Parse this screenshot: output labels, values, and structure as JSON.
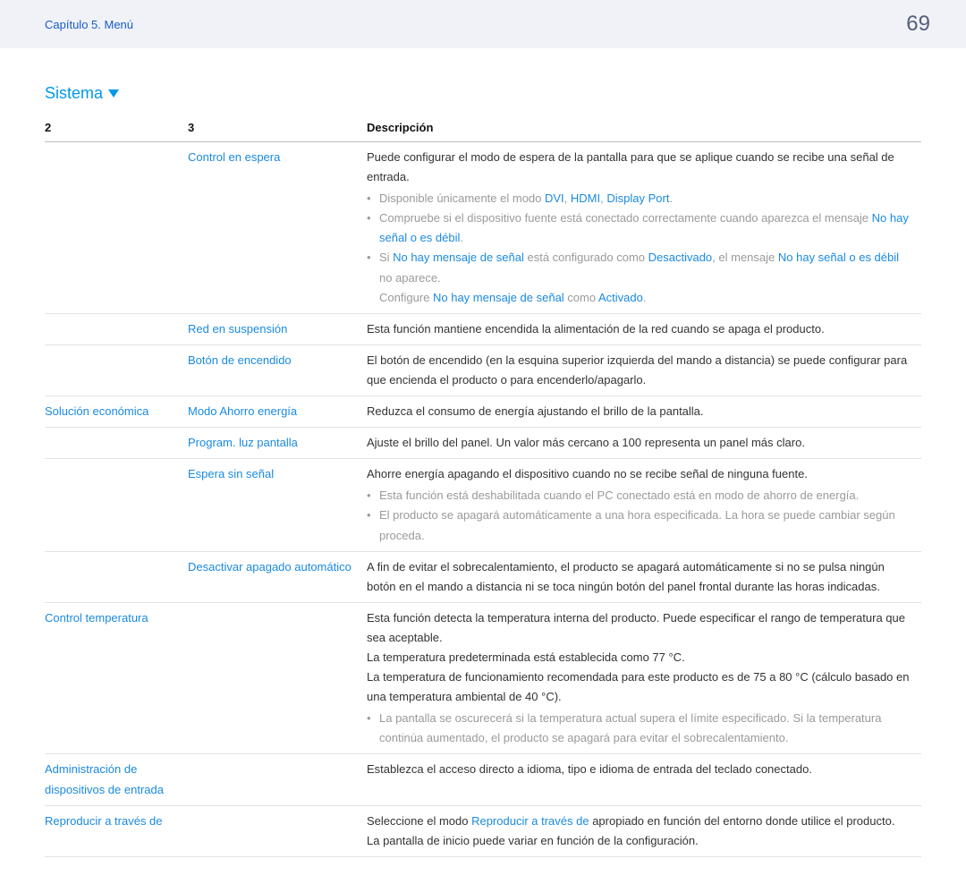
{
  "header": {
    "breadcrumb": "Capítulo 5. Menú",
    "page": "69"
  },
  "section": {
    "title": "Sistema"
  },
  "table": {
    "headers": {
      "c1": "2",
      "c2": "3",
      "c3": "Descripción"
    },
    "rows": [
      {
        "c1": "",
        "c2": "Control en espera",
        "desc": "Puede configurar el modo de espera de la pantalla para que se aplique cuando se recibe una señal de entrada.",
        "notes_html": "<li>Disponible únicamente el modo <span class='hl'>DVI</span>, <span class='hl'>HDMI</span>, <span class='hl'>Display Port</span>.</li><li>Compruebe si el dispositivo fuente está conectado correctamente cuando aparezca el mensaje <span class='hl'>No hay señal o es débil</span>.</li><li>Si <span class='hl'>No hay mensaje de señal</span> está configurado como <span class='hl'>Desactivado</span>, el mensaje <span class='hl'>No hay señal o es débil</span> no aparece.<br>Configure <span class='hl'>No hay mensaje de señal</span> como <span class='hl'>Activado</span>.</li>"
      },
      {
        "c1": "",
        "c2": "Red en suspensión",
        "desc": "Esta función mantiene encendida la alimentación de la red cuando se apaga el producto."
      },
      {
        "c1": "",
        "c2": "Botón de encendido",
        "desc": "El botón de encendido (en la esquina superior izquierda del mando a distancia) se puede configurar para que encienda el producto o para encenderlo/apagarlo."
      },
      {
        "c1": "Solución económica",
        "c2": "Modo Ahorro energía",
        "desc": "Reduzca el consumo de energía ajustando el brillo de la pantalla."
      },
      {
        "c1": "",
        "c2": "Program. luz pantalla",
        "desc": "Ajuste el brillo del panel. Un valor más cercano a 100 representa un panel más claro."
      },
      {
        "c1": "",
        "c2": "Espera sin señal",
        "desc": "Ahorre energía apagando el dispositivo cuando no se recibe señal de ninguna fuente.",
        "notes_html": "<li>Esta función está deshabilitada cuando el PC conectado está en modo de ahorro de energía.</li><li>El producto se apagará automáticamente a una hora especificada. La hora se puede cambiar según proceda.</li>"
      },
      {
        "c1": "",
        "c2": "Desactivar apagado automático",
        "desc": "A fin de evitar el sobrecalentamiento, el producto se apagará automáticamente si no se pulsa ningún botón en el mando a distancia ni se toca ningún botón del panel frontal durante las horas indicadas."
      },
      {
        "c1": "Control temperatura",
        "c2": "",
        "desc": "Esta función detecta la temperatura interna del producto. Puede especificar el rango de temperatura que sea aceptable.<br>La temperatura predeterminada está establecida como 77 °C.<br>La temperatura de funcionamiento recomendada para este producto es de 75 a 80 °C (cálculo basado en una temperatura ambiental de 40 °C).",
        "notes_html": "<li>La pantalla se oscurecerá si la temperatura actual supera el límite especificado. Si la temperatura continúa aumentado, el producto se apagará para evitar el sobrecalentamiento.</li>"
      },
      {
        "c1": "Administración de dispositivos de entrada",
        "c2": "",
        "desc": "Establezca el acceso directo a idioma, tipo e idioma de entrada del teclado conectado."
      },
      {
        "c1": "Reproducir a través de",
        "c2": "",
        "desc_html": "Seleccione el modo <span class='hl'>Reproducir a través de</span> apropiado en función del entorno donde utilice el producto.<br>La pantalla de inicio puede variar en función de la configuración."
      }
    ]
  }
}
